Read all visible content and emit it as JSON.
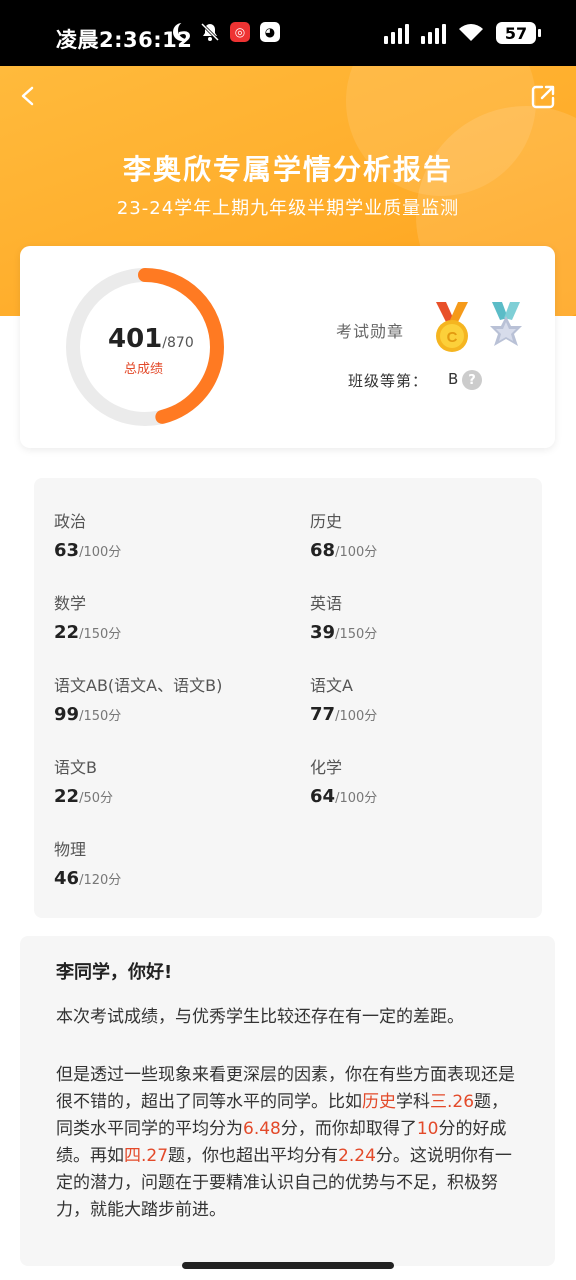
{
  "status_bar": {
    "time": "凌晨2:36:12",
    "battery": "57"
  },
  "header": {
    "title": "李奥欣专属学情分析报告",
    "subtitle": "23-24学年上期九年级半期学业质量监测"
  },
  "score": {
    "value": "401",
    "total": "/870",
    "label": "总成绩",
    "progress_fraction": 0.461
  },
  "medals": {
    "label": "考试勋章",
    "items": [
      "gold-medal-c-icon",
      "silver-star-medal-icon"
    ]
  },
  "rank": {
    "label": "班级等第：",
    "value": "B",
    "help": "?"
  },
  "grades": [
    {
      "name": "政治",
      "score": "63",
      "max": "/100分"
    },
    {
      "name": "历史",
      "score": "68",
      "max": "/100分"
    },
    {
      "name": "数学",
      "score": "22",
      "max": "/150分"
    },
    {
      "name": "英语",
      "score": "39",
      "max": "/150分"
    },
    {
      "name": "语文AB(语文A、语文B)",
      "score": "99",
      "max": "/150分"
    },
    {
      "name": "语文A",
      "score": "77",
      "max": "/100分"
    },
    {
      "name": "语文B",
      "score": "22",
      "max": "/50分"
    },
    {
      "name": "化学",
      "score": "64",
      "max": "/100分"
    },
    {
      "name": "物理",
      "score": "46",
      "max": "/120分"
    }
  ],
  "letter": {
    "greeting": "李同学，你好!",
    "p1": "本次考试成绩，与优秀学生比较还存在有一定的差距。",
    "p2_a": "但是透过一些现象来看更深层的因素，你在有些方面表现还是很不错的，超出了同等水平的同学。比如",
    "p2_subject": "历史",
    "p2_b": "学科",
    "p2_q1": "三.26",
    "p2_c": "题，同类水平同学的平均分为",
    "p2_avg": "6.48",
    "p2_d": "分，而你却取得了",
    "p2_score": "10",
    "p2_e": "分的好成绩。再如",
    "p2_q2": "四.27",
    "p2_f": "题，你也超出平均分有",
    "p2_diff": "2.24",
    "p2_g": "分。这说明你有一定的潜力，问题在于要精准认识自己的优势与不足，积极努力，就能大踏步前进。"
  }
}
